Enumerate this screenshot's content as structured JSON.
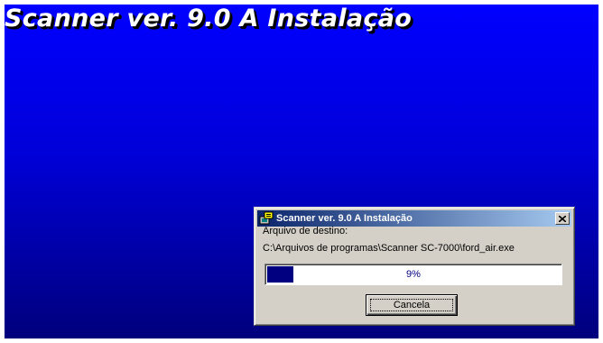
{
  "installer": {
    "title": "Scanner ver. 9.0 A Instalação",
    "background_top": "#0000ff",
    "background_bottom": "#00007c"
  },
  "dialog": {
    "title": "Scanner ver. 9.0 A Instalação",
    "icon": "installer-app-icon",
    "close_icon": "close-icon",
    "titlebar_color": "#0a246a",
    "destination_label": "Arquivo de destino:",
    "destination_path": "C:\\Arquivos de programas\\Scanner SC-7000\\ford_air.exe",
    "progress": {
      "percent_text": "9%",
      "value": 0.09,
      "fill_color": "#000080"
    },
    "cancel_label": "Cancela"
  }
}
